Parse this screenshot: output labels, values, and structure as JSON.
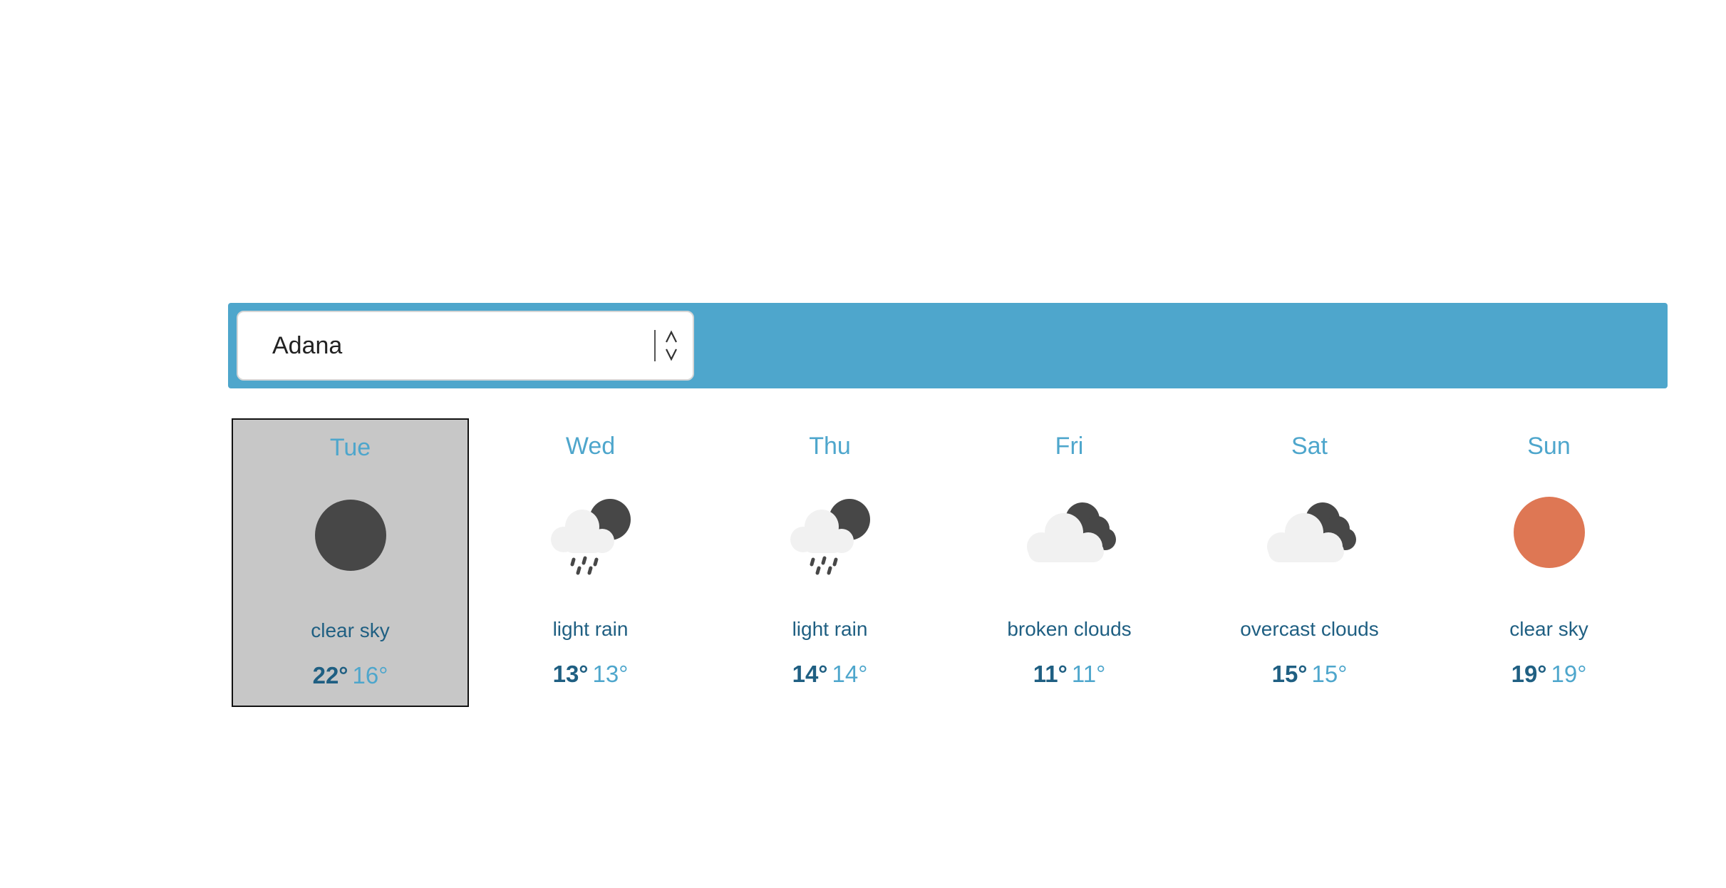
{
  "search": {
    "city_value": "Adana"
  },
  "colors": {
    "bar": "#4ea6cc",
    "day_label": "#4ea6cc",
    "description": "#1f5f82",
    "selected_bg": "#c7c7c7",
    "sun": "#de7754",
    "moon": "#474747",
    "cloud": "#f1f1f1"
  },
  "forecast": [
    {
      "day": "Tue",
      "icon": "clear-sky-night-icon",
      "description": "clear sky",
      "high": "22°",
      "low": "16°",
      "selected": true
    },
    {
      "day": "Wed",
      "icon": "light-rain-night-icon",
      "description": "light rain",
      "high": "13°",
      "low": "13°",
      "selected": false
    },
    {
      "day": "Thu",
      "icon": "light-rain-night-icon",
      "description": "light rain",
      "high": "14°",
      "low": "14°",
      "selected": false
    },
    {
      "day": "Fri",
      "icon": "broken-clouds-icon",
      "description": "broken clouds",
      "high": "11°",
      "low": "11°",
      "selected": false
    },
    {
      "day": "Sat",
      "icon": "overcast-clouds-icon",
      "description": "overcast clouds",
      "high": "15°",
      "low": "15°",
      "selected": false
    },
    {
      "day": "Sun",
      "icon": "clear-sky-day-icon",
      "description": "clear sky",
      "high": "19°",
      "low": "19°",
      "selected": false
    }
  ]
}
